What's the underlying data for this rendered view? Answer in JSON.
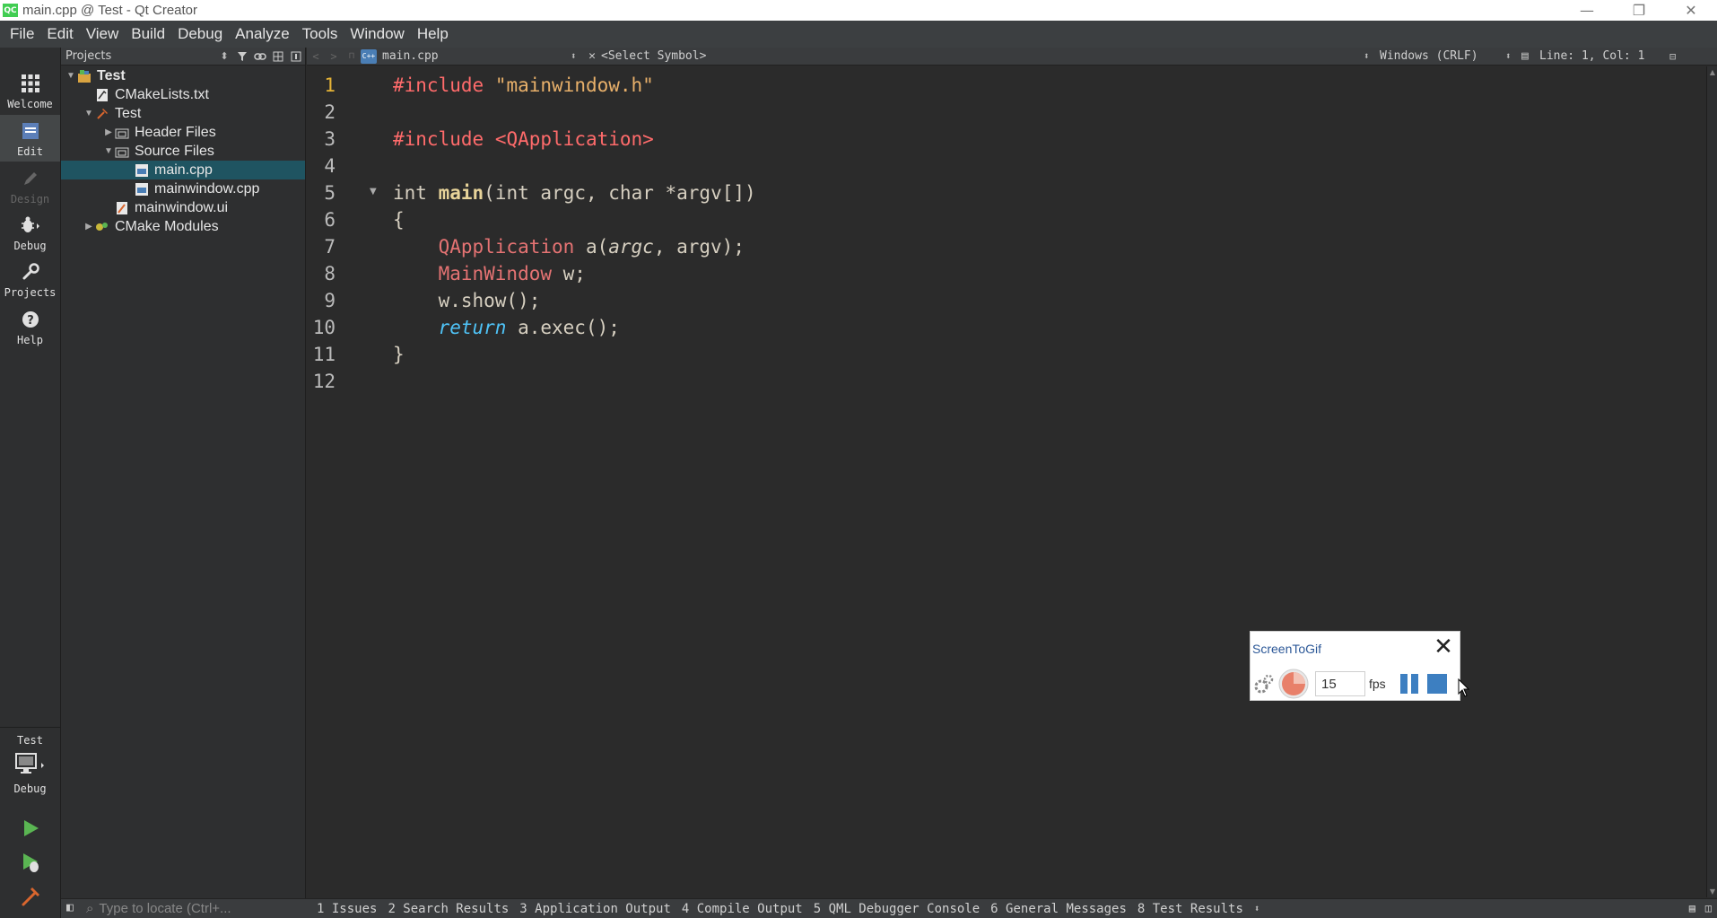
{
  "window": {
    "title": "main.cpp @ Test - Qt Creator",
    "app_icon_text": "QC",
    "minimize": "—",
    "restore": "❐",
    "close": "✕"
  },
  "menubar": [
    {
      "label": "File"
    },
    {
      "label": "Edit"
    },
    {
      "label": "View"
    },
    {
      "label": "Build"
    },
    {
      "label": "Debug"
    },
    {
      "label": "Analyze"
    },
    {
      "label": "Tools"
    },
    {
      "label": "Window"
    },
    {
      "label": "Help"
    }
  ],
  "modes": {
    "welcome": "Welcome",
    "edit": "Edit",
    "design": "Design",
    "debug": "Debug",
    "projects": "Projects",
    "help": "Help",
    "kit_project": "Test",
    "kit_build": "Debug"
  },
  "projects_pane": {
    "title": "Projects",
    "tree": [
      {
        "label": "Test"
      },
      {
        "label": "CMakeLists.txt"
      },
      {
        "label": "Test"
      },
      {
        "label": "Header Files"
      },
      {
        "label": "Source Files"
      },
      {
        "label": "main.cpp"
      },
      {
        "label": "mainwindow.cpp"
      },
      {
        "label": "mainwindow.ui"
      },
      {
        "label": "CMake Modules"
      }
    ]
  },
  "editor_header": {
    "file": "main.cpp",
    "file_icon_text": "C++",
    "symbol": "<Select Symbol>",
    "line_ending": "Windows (CRLF)",
    "position": "Line: 1, Col: 1"
  },
  "editor": {
    "line_numbers": [
      "1",
      "2",
      "3",
      "4",
      "5",
      "6",
      "7",
      "8",
      "9",
      "10",
      "11",
      "12"
    ],
    "current_line": 1
  },
  "bottombar": {
    "locate_placeholder": "Type to locate (Ctrl+...",
    "tabs": [
      "1 Issues",
      "2 Search Results",
      "3 Application Output",
      "4 Compile Output",
      "5 QML Debugger Console",
      "6 General Messages",
      "8 Test Results"
    ]
  },
  "screentogif": {
    "title": "ScreenToGif",
    "fps_value": "15",
    "fps_label": "fps"
  },
  "colors": {
    "background": "#2b2b2b",
    "selection": "#1f5461",
    "preprocessor": "#ff6b6b",
    "string": "#e8b06a",
    "keyword_italic": "#4fc3f7",
    "stg_accent": "#3d7fc1"
  }
}
